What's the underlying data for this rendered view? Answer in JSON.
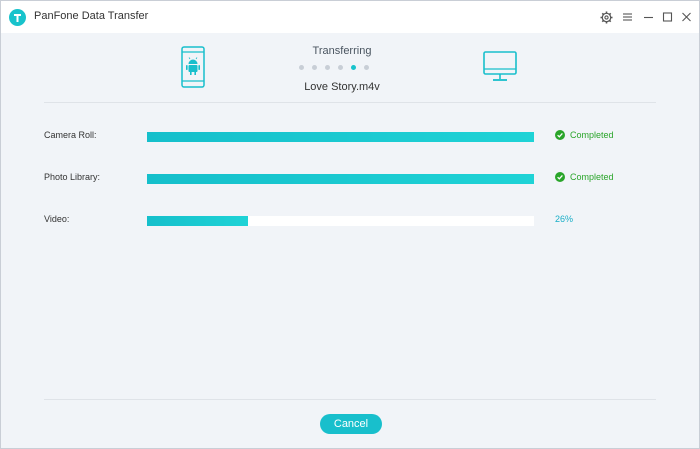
{
  "app": {
    "title": "PanFone Data Transfer",
    "accent_color": "#18c3cc",
    "logo_icon": "panfone-logo-icon"
  },
  "window_controls": {
    "icons": [
      "gear-icon",
      "menu-icon",
      "minimize-icon",
      "maximize-icon",
      "close-icon"
    ]
  },
  "transfer": {
    "status": "Transferring",
    "current_file": "Love Story.m4v",
    "source_device_icon": "android-phone-icon",
    "target_device_icon": "computer-monitor-icon",
    "dots_total": 5,
    "dots_active_index": 4
  },
  "items": [
    {
      "label": "Camera Roll:",
      "progress": 1.0,
      "status": "Completed",
      "status_color": "#2aa52a"
    },
    {
      "label": "Photo Library:",
      "progress": 1.0,
      "status": "Completed",
      "status_color": "#2aa52a"
    },
    {
      "label": "Video:",
      "progress": 0.26,
      "status": "26%",
      "status_color": "#18aec7"
    }
  ],
  "footer": {
    "cancel_label": "Cancel"
  }
}
